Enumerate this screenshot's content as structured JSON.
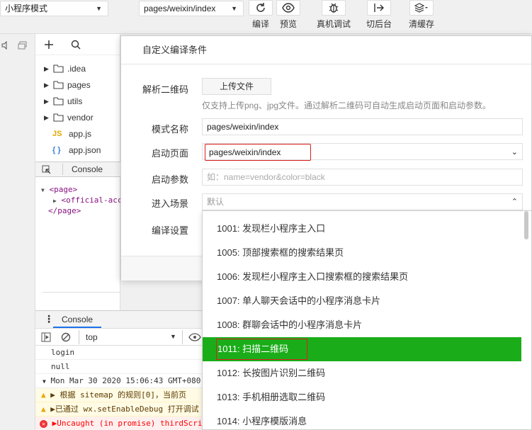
{
  "toolbar": {
    "mode_select": "小程序模式",
    "page_select": "pages/weixin/index",
    "buttons": [
      {
        "icon": "refresh-icon",
        "label": "编译"
      },
      {
        "icon": "eye-icon",
        "label": "预览"
      },
      {
        "icon": "bug-icon",
        "label": "真机调试"
      },
      {
        "icon": "switch-background-icon",
        "label": "切后台"
      },
      {
        "icon": "layers-icon",
        "label": "清缓存"
      }
    ]
  },
  "file_tree": {
    "items": [
      {
        "type": "folder",
        "label": ".idea"
      },
      {
        "type": "folder",
        "label": "pages"
      },
      {
        "type": "folder",
        "label": "utils"
      },
      {
        "type": "folder",
        "label": "vendor"
      },
      {
        "type": "js",
        "icon_text": "JS",
        "label": "app.js"
      },
      {
        "type": "json",
        "icon_text": "{ }",
        "label": "app.json"
      }
    ]
  },
  "debug_panel": {
    "tab": "Console",
    "elements": [
      "<page>",
      "<official-acc",
      "</page>"
    ]
  },
  "console": {
    "tab": "Console",
    "filter_context": "top",
    "rows": [
      {
        "kind": "log",
        "text": "login"
      },
      {
        "kind": "log",
        "text": "null"
      },
      {
        "kind": "group",
        "text": "Mon Mar 30 2020 15:06:43 GMT+080"
      },
      {
        "kind": "warn",
        "text": "▶ 根据 sitemap 的规则[0]，当前页"
      },
      {
        "kind": "warn",
        "text": "▶已通过 wx.setEnableDebug 打开调试"
      },
      {
        "kind": "err",
        "text": "▶Uncaught (in promise) thirdScriptError"
      }
    ]
  },
  "dialog": {
    "title": "自定义编译条件",
    "qr_label": "解析二维码",
    "upload_button": "上传文件",
    "qr_hint": "仅支持上传png、jpg文件。通过解析二维码可自动生成启动页面和启动参数。",
    "mode_name_label": "模式名称",
    "mode_name_value": "pages/weixin/index",
    "start_page_label": "启动页面",
    "start_page_value": "pages/weixin/index",
    "start_params_label": "启动参数",
    "start_params_placeholder": "如：name=vendor&color=black",
    "scene_label": "进入场景",
    "scene_placeholder": "默认",
    "compile_settings_label": "编译设置"
  },
  "scene_dropdown": {
    "options": [
      "1001: 发现栏小程序主入口",
      "1005: 顶部搜索框的搜索结果页",
      "1006: 发现栏小程序主入口搜索框的搜索结果页",
      "1007: 单人聊天会话中的小程序消息卡片",
      "1008: 群聊会话中的小程序消息卡片",
      "1011: 扫描二维码",
      "1012: 长按图片识别二维码",
      "1013: 手机相册选取二维码",
      "1014: 小程序模版消息"
    ],
    "selected_index": 5
  },
  "colors": {
    "accent": "#1aad19",
    "highlight_border": "#d9201e",
    "warn_bg": "#fffbe5",
    "error_text": "#ff0000"
  }
}
